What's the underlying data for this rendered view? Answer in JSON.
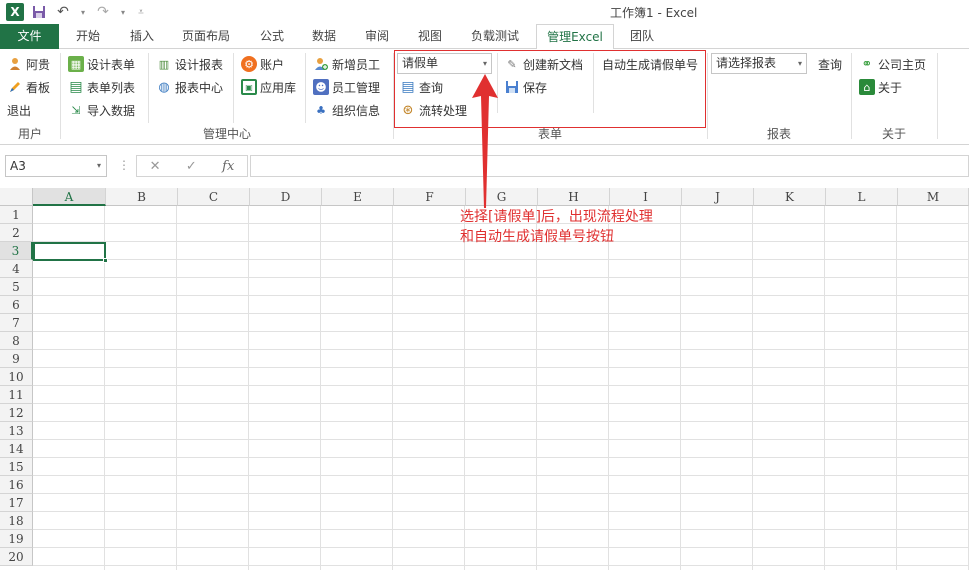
{
  "window": {
    "title": "工作簿1 - Excel",
    "app_icon": "excel-icon",
    "quick_access": [
      "save-icon",
      "undo-icon",
      "redo-icon",
      "customize-icon"
    ]
  },
  "tabs": [
    "文件",
    "开始",
    "插入",
    "页面布局",
    "公式",
    "数据",
    "审阅",
    "视图",
    "负载测试",
    "管理Excel",
    "团队"
  ],
  "active_tab": "管理Excel",
  "ribbon": {
    "groups": {
      "user": {
        "label": "用户",
        "items": [
          "阿贵",
          "看板",
          "退出"
        ]
      },
      "management": {
        "label": "管理中心",
        "items": [
          "设计表单",
          "表单列表",
          "导入数据",
          "设计报表",
          "报表中心",
          "账户",
          "应用库",
          "新增员工",
          "员工管理",
          "组织信息"
        ]
      },
      "form": {
        "label": "表单",
        "select_value": "请假单",
        "items": [
          "查询",
          "流转处理",
          "创建新文档",
          "保存",
          "自动生成请假单号"
        ]
      },
      "report": {
        "label": "报表",
        "select_value": "请选择报表",
        "query": "查询"
      },
      "about": {
        "label": "关于",
        "items": [
          "公司主页",
          "关于"
        ]
      }
    }
  },
  "formula_bar": {
    "name_box": "A3",
    "cancel": "✕",
    "enter": "✓",
    "fx": "fx",
    "value": ""
  },
  "sheet": {
    "columns": [
      "A",
      "B",
      "C",
      "D",
      "E",
      "F",
      "G",
      "H",
      "I",
      "J",
      "K",
      "L",
      "M"
    ],
    "rows": [
      "1",
      "2",
      "3",
      "4",
      "5",
      "6",
      "7",
      "8",
      "9",
      "10",
      "11",
      "12",
      "13",
      "14",
      "15",
      "16",
      "17",
      "18",
      "19",
      "20"
    ],
    "active_cell": "A3"
  },
  "annotation": {
    "line1": "选择[请假单]后，出现流程处理",
    "line2": "和自动生成请假单号按钮",
    "color": "#e03030"
  },
  "colors": {
    "accent": "#217346"
  }
}
